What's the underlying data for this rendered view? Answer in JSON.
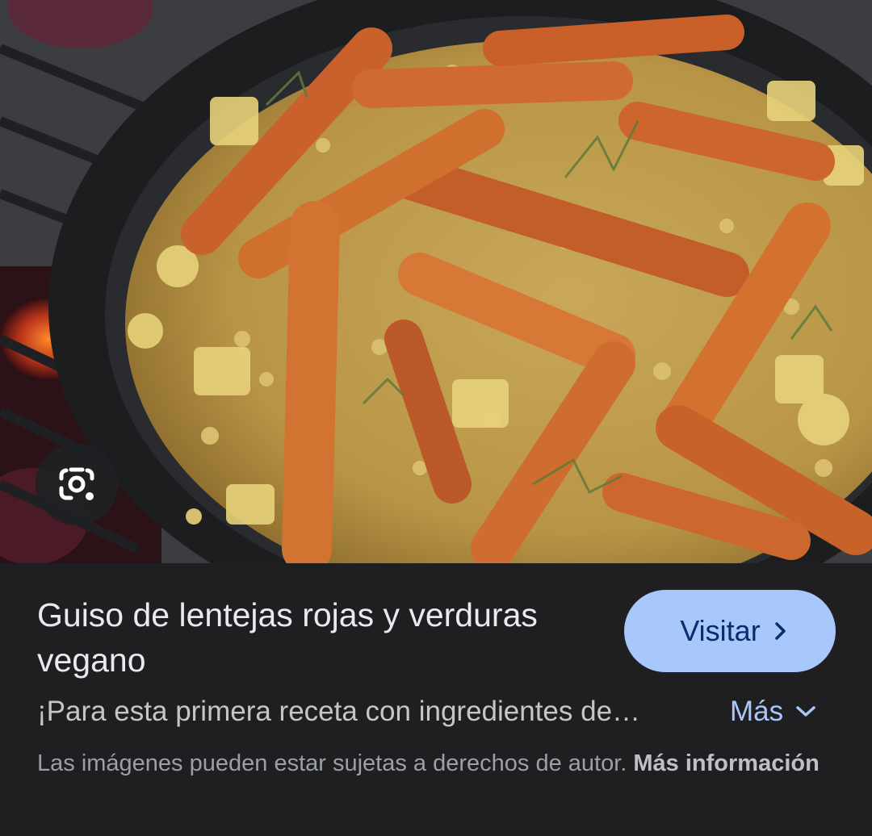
{
  "image": {
    "description_icon": "lens-camera-icon"
  },
  "result": {
    "title": "Guiso de lentejas rojas y verduras vegano",
    "visit_label": "Visitar",
    "snippet": "¡Para esta primera receta con ingredientes de…",
    "more_label": "Más",
    "copyright_text": "Las imágenes pueden estar sujetas a derechos de autor.",
    "more_info_label": "Más información"
  },
  "colors": {
    "panel_bg": "#1f1f22",
    "button_bg": "#a8c7fa",
    "button_text": "#062e6f",
    "link": "#a8c7fa",
    "title_text": "#e8eaed"
  }
}
